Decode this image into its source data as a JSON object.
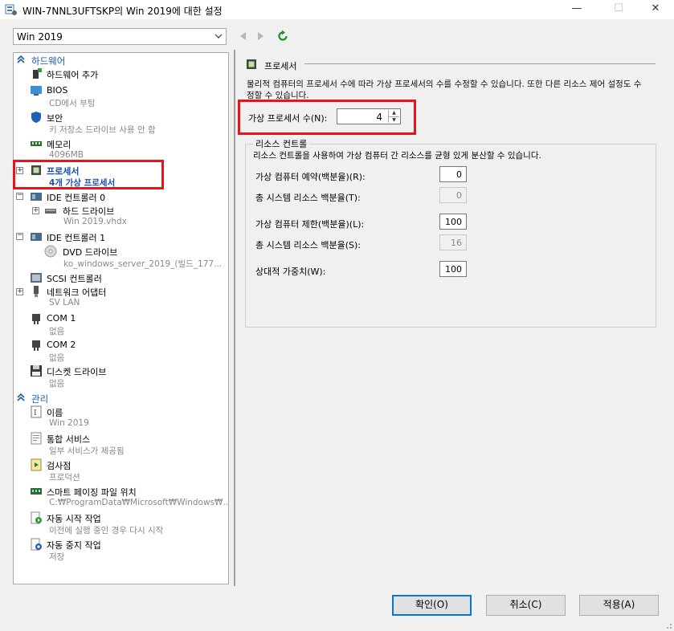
{
  "window": {
    "title": "WIN-7NNL3UFTSKP의 Win 2019에 대한 설정",
    "minimize": "—",
    "maximize": "☐",
    "close": "✕"
  },
  "vm_selector": {
    "value": "Win 2019"
  },
  "sections": {
    "hardware": "하드웨어",
    "management": "관리"
  },
  "tree": {
    "add_hardware": {
      "label": "하드웨어 추가"
    },
    "bios": {
      "label": "BIOS",
      "sub": "CD에서 부팅"
    },
    "security": {
      "label": "보안",
      "sub": "키 저장소 드라이브 사용 안 함"
    },
    "memory": {
      "label": "메모리",
      "sub": "4096MB"
    },
    "processor": {
      "label": "프로세서",
      "sub": "4개 가상 프로세서"
    },
    "ide0": {
      "label": "IDE 컨트롤러 0"
    },
    "hdd": {
      "label": "하드 드라이브",
      "sub": "Win 2019.vhdx"
    },
    "ide1": {
      "label": "IDE 컨트롤러 1"
    },
    "dvd": {
      "label": "DVD 드라이브",
      "sub": "ko_windows_server_2019_(빌드_177..."
    },
    "scsi": {
      "label": "SCSI 컨트롤러"
    },
    "network": {
      "label": "네트워크 어댑터",
      "sub": "SV LAN"
    },
    "com1": {
      "label": "COM 1",
      "sub": "없음"
    },
    "com2": {
      "label": "COM 2",
      "sub": "없음"
    },
    "diskette": {
      "label": "디스켓 드라이브",
      "sub": "없음"
    },
    "name": {
      "label": "이름",
      "sub": "Win 2019"
    },
    "integration": {
      "label": "통합 서비스",
      "sub": "일부 서비스가 제공됨"
    },
    "checkpoints": {
      "label": "검사점",
      "sub": "프로덕션"
    },
    "paging": {
      "label": "스마트 페이징 파일 위치",
      "sub": "C:₩ProgramData₩Microsoft₩Windows₩..."
    },
    "autostart": {
      "label": "자동 시작 작업",
      "sub": "이전에 실행 중인 경우 다시 시작"
    },
    "autostop": {
      "label": "자동 중지 작업",
      "sub": "저장"
    }
  },
  "processor_panel": {
    "title": "프로세서",
    "description": "물리적 컴퓨터의 프로세서 수에 따라 가상 프로세서의 수를 수정할 수 있습니다. 또한 다른 리소스 제어 설정도 수정할 수 있습니다.",
    "count_label": "가상 프로세서 수(N):",
    "count_value": "4",
    "resource_control": {
      "title": "리소스 컨트롤",
      "description": "리소스 컨트롤을 사용하여 가상 컴퓨터 간 리소스를 균형 있게 분산할 수 있습니다.",
      "reserve_label": "가상 컴퓨터 예약(백분율)(R):",
      "reserve_value": "0",
      "reserve_total_label": "총 시스템 리소스 백분율(T):",
      "reserve_total_value": "0",
      "limit_label": "가상 컴퓨터 제한(백분율)(L):",
      "limit_value": "100",
      "limit_total_label": "총 시스템 리소스 백분율(S):",
      "limit_total_value": "16",
      "weight_label": "상대적 가중치(W):",
      "weight_value": "100"
    }
  },
  "buttons": {
    "ok": "확인(O)",
    "cancel": "취소(C)",
    "apply": "적용(A)"
  },
  "colors": {
    "accent": "#0078d7",
    "highlight": "#e8141c",
    "section_text": "#1e5aa8"
  }
}
